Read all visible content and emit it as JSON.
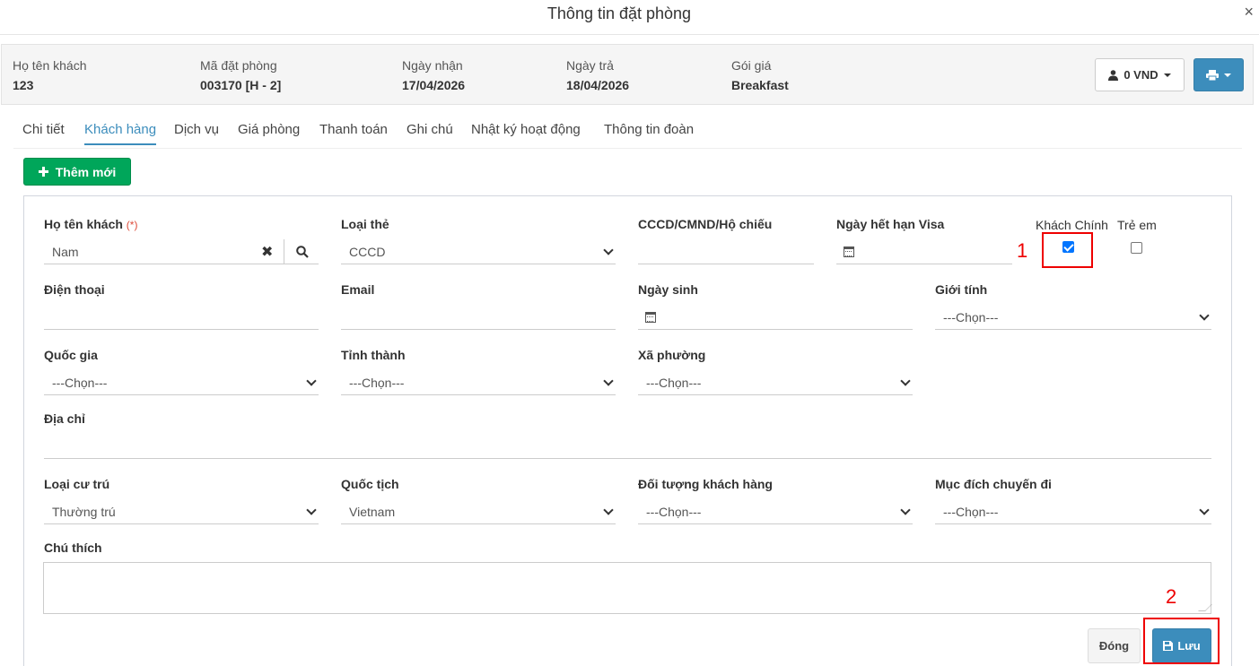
{
  "modal": {
    "title": "Thông tin đặt phòng",
    "close_glyph": "×"
  },
  "summary": {
    "guest_label": "Họ tên khách",
    "guest_value": "123",
    "code_label": "Mã đặt phòng",
    "code_value": "003170 [H - 2]",
    "checkin_label": "Ngày nhận",
    "checkin_value": "17/04/2026",
    "checkout_label": "Ngày trả",
    "checkout_value": "18/04/2026",
    "rate_label": "Gói giá",
    "rate_value": "Breakfast",
    "balance_label": "0 VND"
  },
  "tabs": [
    "Chi tiết",
    "Khách hàng",
    "Dịch vụ",
    "Giá phòng",
    "Thanh toán",
    "Ghi chú",
    "Nhật ký hoạt động",
    "Thông tin đoàn"
  ],
  "active_tab": "Khách hàng",
  "add_button": "Thêm mới",
  "form": {
    "guest_name_label": "Họ tên khách",
    "required_mark": "(*)",
    "guest_name_value": "Nam",
    "card_type_label": "Loại thẻ",
    "card_type_value": "CCCD",
    "id_label": "CCCD/CMND/Hộ chiếu",
    "id_value": "",
    "visa_label": "Ngày hết hạn Visa",
    "main_guest_label": "Khách Chính",
    "main_guest_checked": true,
    "child_label": "Trẻ em",
    "child_checked": false,
    "phone_label": "Điện thoại",
    "email_label": "Email",
    "dob_label": "Ngày sinh",
    "gender_label": "Giới tính",
    "gender_value": "---Chọn---",
    "country_label": "Quốc gia",
    "country_value": "---Chọn---",
    "province_label": "Tỉnh thành",
    "province_value": "---Chọn---",
    "ward_label": "Xã phường",
    "ward_value": "---Chọn---",
    "address_label": "Địa chỉ",
    "residence_label": "Loại cư trú",
    "residence_value": "Thường trú",
    "nationality_label": "Quốc tịch",
    "nationality_value": "Vietnam",
    "customer_type_label": "Đối tượng khách hàng",
    "customer_type_value": "---Chọn---",
    "purpose_label": "Mục đích chuyến đi",
    "purpose_value": "---Chọn---",
    "note_label": "Chú thích"
  },
  "footer": {
    "close_label": "Đóng",
    "save_label": "Lưu"
  },
  "annotations": {
    "one": "1",
    "two": "2"
  },
  "colors": {
    "primary": "#3c8dbc",
    "success": "#00a65a",
    "annotation": "#ee0000"
  }
}
